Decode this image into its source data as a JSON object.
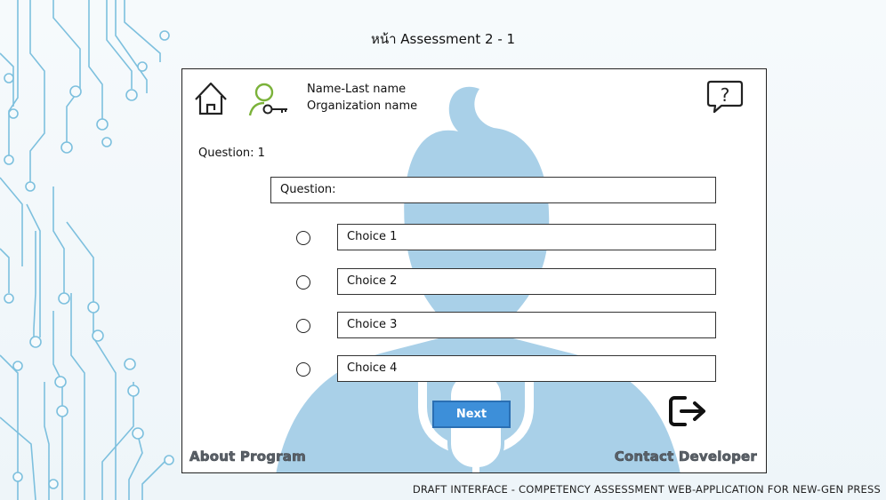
{
  "page_title": "หน้า Assessment 2 - 1",
  "header": {
    "user_name": "Name-Last name",
    "organization": "Organization name",
    "icons": {
      "home": "home-icon",
      "user": "user-key-icon",
      "help": "help-chat-icon"
    }
  },
  "question": {
    "number_label": "Question: 1",
    "text": "Question:"
  },
  "choices": [
    {
      "label": "Choice 1"
    },
    {
      "label": "Choice 2"
    },
    {
      "label": "Choice 3"
    },
    {
      "label": "Choice 4"
    }
  ],
  "actions": {
    "next_label": "Next",
    "exit_icon": "exit-icon"
  },
  "footer": {
    "about_label": "About Program",
    "contact_label": "Contact Developer",
    "draft_note": "DRAFT INTERFACE - COMPETENCY ASSESSMENT WEB-APPLICATION FOR NEW-GEN PRESS"
  },
  "colors": {
    "accent_blue": "#3d8fd9",
    "silhouette": "#a9d0e8",
    "circuit": "#6fb6d8",
    "user_icon_green": "#7bb23a"
  }
}
